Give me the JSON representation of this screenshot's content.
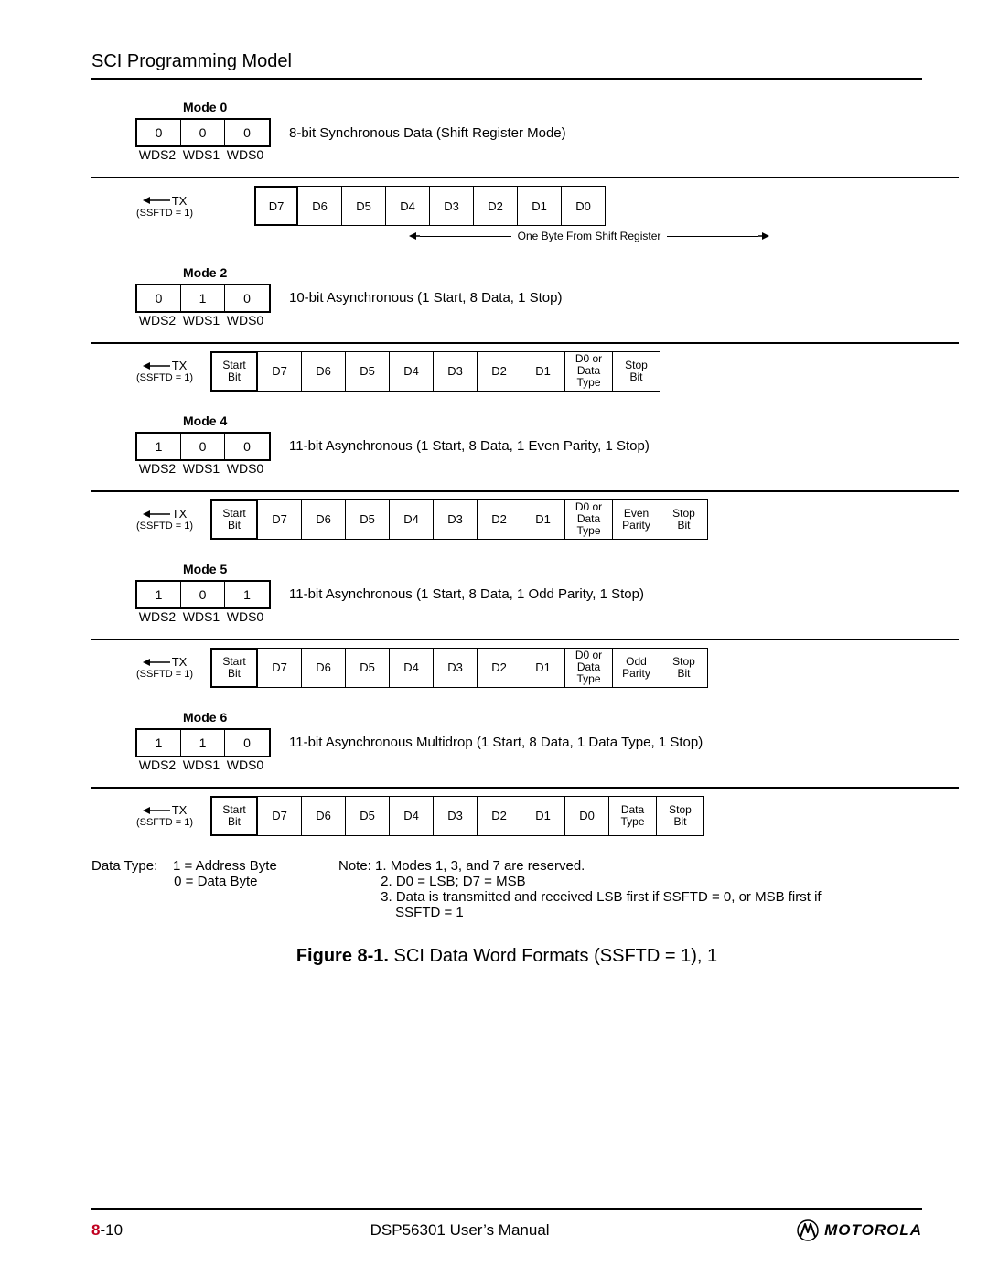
{
  "header": {
    "section_title": "SCI Programming Model"
  },
  "wds_labels": [
    "WDS2",
    "WDS1",
    "WDS0"
  ],
  "tx": {
    "label": "TX",
    "sub": "(SSFTD = 1)"
  },
  "modes": [
    {
      "name": "Mode 0",
      "bits": [
        "0",
        "0",
        "0"
      ],
      "desc": "8-bit Synchronous Data (Shift Register Mode)",
      "frame": {
        "lead_gap": true,
        "cells": [
          "D7",
          "D6",
          "D5",
          "D4",
          "D3",
          "D2",
          "D1",
          "D0"
        ],
        "under_caption": "One Byte From Shift Register"
      }
    },
    {
      "name": "Mode 2",
      "bits": [
        "0",
        "1",
        "0"
      ],
      "desc": "10-bit Asynchronous (1 Start, 8 Data, 1 Stop)",
      "frame": {
        "cells": [
          "Start|Bit",
          "D7",
          "D6",
          "D5",
          "D4",
          "D3",
          "D2",
          "D1",
          "D0 or|Data|Type",
          "Stop|Bit"
        ]
      }
    },
    {
      "name": "Mode 4",
      "bits": [
        "1",
        "0",
        "0"
      ],
      "desc": "11-bit Asynchronous (1 Start, 8 Data, 1 Even Parity, 1 Stop)",
      "frame": {
        "cells": [
          "Start|Bit",
          "D7",
          "D6",
          "D5",
          "D4",
          "D3",
          "D2",
          "D1",
          "D0 or|Data|Type",
          "Even|Parity",
          "Stop|Bit"
        ]
      }
    },
    {
      "name": "Mode 5",
      "bits": [
        "1",
        "0",
        "1"
      ],
      "desc": "11-bit Asynchronous (1 Start, 8 Data, 1 Odd Parity, 1 Stop)",
      "frame": {
        "cells": [
          "Start|Bit",
          "D7",
          "D6",
          "D5",
          "D4",
          "D3",
          "D2",
          "D1",
          "D0 or|Data|Type",
          "Odd|Parity",
          "Stop|Bit"
        ]
      }
    },
    {
      "name": "Mode 6",
      "bits": [
        "1",
        "1",
        "0"
      ],
      "desc": "11-bit Asynchronous Multidrop (1 Start, 8 Data, 1 Data Type, 1 Stop)",
      "frame": {
        "cells": [
          "Start|Bit",
          "D7",
          "D6",
          "D5",
          "D4",
          "D3",
          "D2",
          "D1",
          "D0",
          "Data|Type",
          "Stop|Bit"
        ]
      }
    }
  ],
  "data_type_note": {
    "title": "Data Type:",
    "l1": "1 = Address Byte",
    "l2": "0 = Data Byte"
  },
  "notes": {
    "title": "Note:",
    "n1": "1. Modes 1, 3, and 7 are reserved.",
    "n2": "2. D0 = LSB; D7 = MSB",
    "n3": "3. Data is transmitted and received LSB first if SSFTD = 0, or MSB first if",
    "n3b": "SSFTD = 1"
  },
  "figure_caption": {
    "bold": "Figure 8-1.",
    "rest": " SCI Data Word Formats (SSFTD = 1), 1"
  },
  "footer": {
    "page_prefix": "8",
    "page_suffix": "-10",
    "doc": "DSP56301 User’s Manual",
    "brand": "MOTOROLA"
  }
}
